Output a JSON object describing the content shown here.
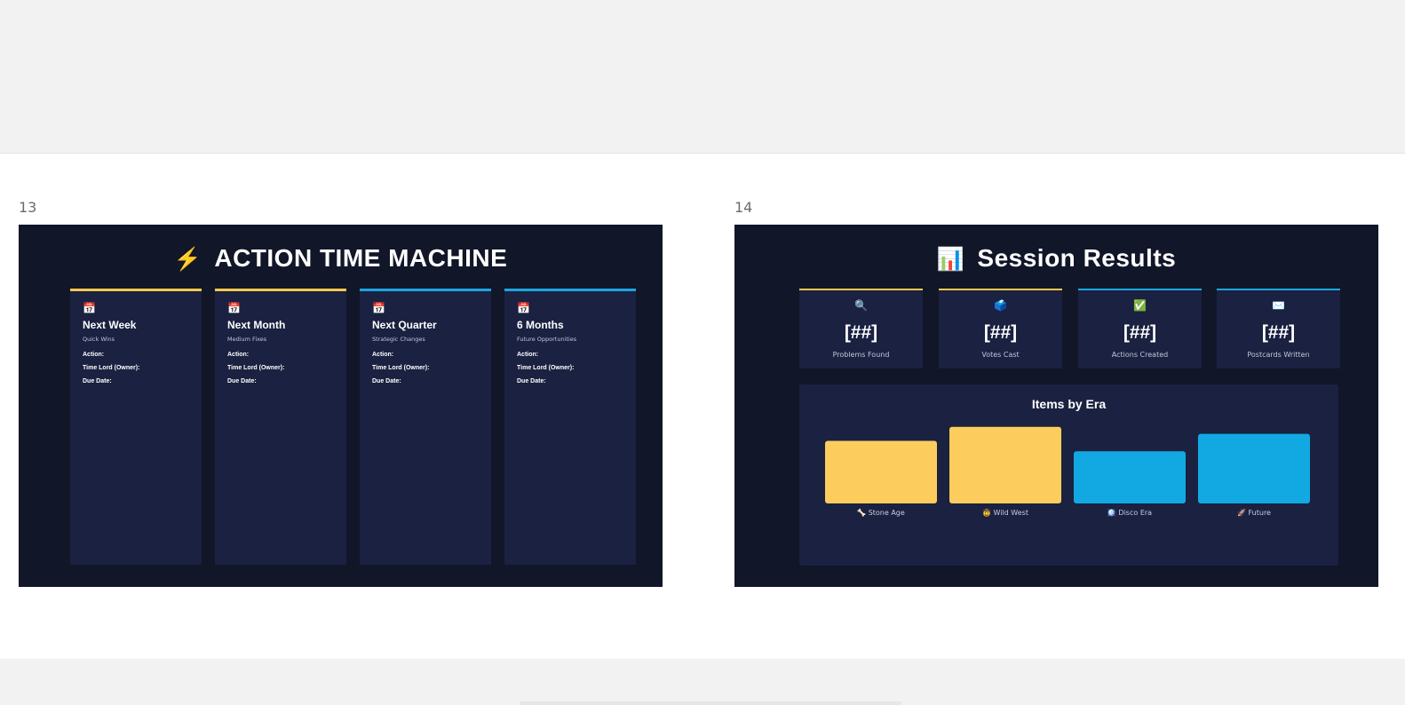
{
  "slides": [
    {
      "number": "13",
      "title_emoji": "⚡",
      "title": "ACTION TIME MACHINE",
      "columns": [
        {
          "icon": "📅",
          "title": "Next Week",
          "subtitle": "Quick Wins",
          "fields": [
            "Action:",
            "Time Lord (Owner):",
            "Due Date:"
          ],
          "accent": "#f8c84e"
        },
        {
          "icon": "📅",
          "title": "Next Month",
          "subtitle": "Medium Fixes",
          "fields": [
            "Action:",
            "Time Lord (Owner):",
            "Due Date:"
          ],
          "accent": "#f8c84e"
        },
        {
          "icon": "📅",
          "title": "Next Quarter",
          "subtitle": "Strategic Changes",
          "fields": [
            "Action:",
            "Time Lord (Owner):",
            "Due Date:"
          ],
          "accent": "#1ca6e0"
        },
        {
          "icon": "📅",
          "title": "6 Months",
          "subtitle": "Future Opportunities",
          "fields": [
            "Action:",
            "Time Lord (Owner):",
            "Due Date:"
          ],
          "accent": "#1ca6e0"
        }
      ]
    },
    {
      "number": "14",
      "title_emoji": "📊",
      "title": "Session Results",
      "stats": [
        {
          "icon": "🔍",
          "value": "[##]",
          "label": "Problems Found"
        },
        {
          "icon": "🗳️",
          "value": "[##]",
          "label": "Votes Cast"
        },
        {
          "icon": "✅",
          "value": "[##]",
          "label": "Actions Created"
        },
        {
          "icon": "✉️",
          "value": "[##]",
          "label": "Postcards Written"
        }
      ]
    }
  ],
  "chart_data": {
    "type": "bar",
    "title": "Items by Era",
    "categories": [
      "🦴 Stone Age",
      "🤠 Wild West",
      "🪩 Disco Era",
      "🚀 Future"
    ],
    "values": [
      72,
      88,
      60,
      80
    ],
    "ylim": [
      0,
      100
    ],
    "colors": [
      "#fccd5d",
      "#fccd5d",
      "#12a9e3",
      "#12a9e3"
    ],
    "grid": false,
    "legend": "none"
  },
  "colors": {
    "slide_bg": "#111629",
    "card_bg": "#1a2141",
    "gold": "#f8c84e",
    "blue": "#1ca6e0"
  }
}
